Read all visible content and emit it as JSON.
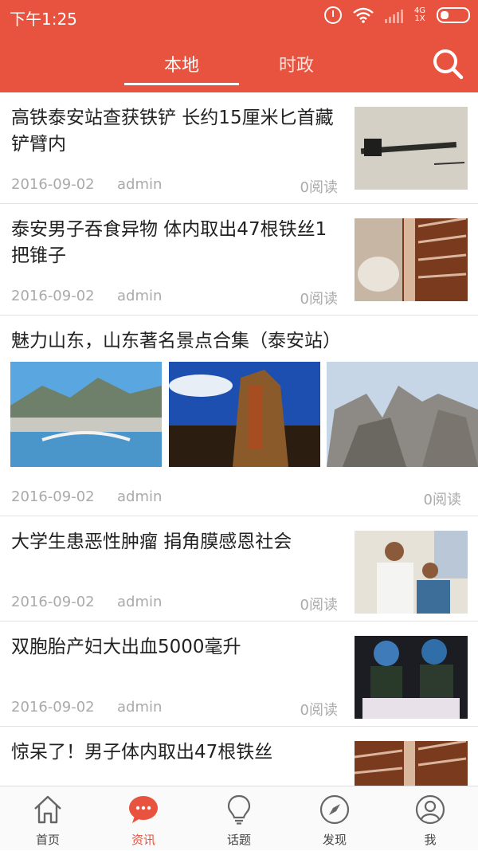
{
  "status_bar": {
    "time": "下午1:25",
    "network": "4G",
    "network2": "1X"
  },
  "header": {
    "tabs": [
      {
        "label": "本地",
        "active": true
      },
      {
        "label": "时政",
        "active": false
      }
    ],
    "search_icon": "search-icon"
  },
  "feed": [
    {
      "title": "高铁泰安站查获铁铲 长约15厘米匕首藏铲臂内",
      "date": "2016-09-02",
      "author": "admin",
      "reads": "0阅读",
      "image": "shovel-photo"
    },
    {
      "title": "泰安男子吞食异物  体内取出47根铁丝1把锥子",
      "date": "2016-09-02",
      "author": "admin",
      "reads": "0阅读",
      "image": "xray-photo"
    },
    {
      "title": "魅力山东，山东著名景点合集（泰安站）",
      "date": "2016-09-02",
      "author": "admin",
      "reads": "0阅读",
      "images": [
        "city-lake-photo",
        "carved-rock-photo",
        "mountain-rocks-photo"
      ]
    },
    {
      "title": "大学生患恶性肿瘤 捐角膜感恩社会",
      "date": "2016-09-02",
      "author": "admin",
      "reads": "0阅读",
      "image": "people-photo"
    },
    {
      "title": "双胞胎产妇大出血5000毫升",
      "date": "2016-09-02",
      "author": "admin",
      "reads": "0阅读",
      "image": "hospital-photo"
    },
    {
      "title": "惊呆了！男子体内取出47根铁丝",
      "date": "",
      "author": "",
      "reads": "",
      "image": "xray-photo"
    }
  ],
  "tab_bar": [
    {
      "label": "首页",
      "icon": "home-icon",
      "active": false
    },
    {
      "label": "资讯",
      "icon": "chat-bubble-icon",
      "active": true
    },
    {
      "label": "话题",
      "icon": "lightbulb-icon",
      "active": false
    },
    {
      "label": "发现",
      "icon": "compass-icon",
      "active": false
    },
    {
      "label": "我",
      "icon": "user-icon",
      "active": false
    }
  ],
  "colors": {
    "accent": "#e8533f"
  }
}
